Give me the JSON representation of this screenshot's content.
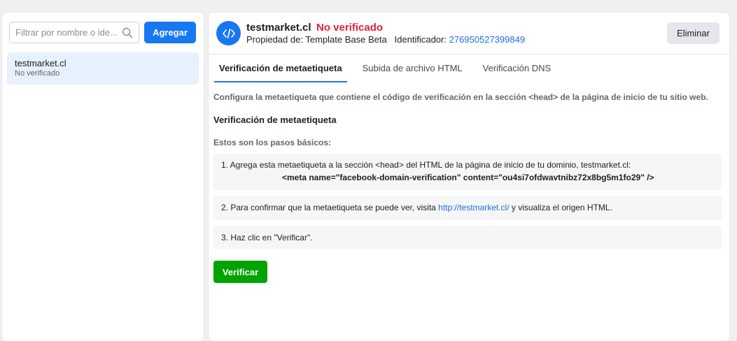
{
  "sidebar": {
    "search": {
      "placeholder": "Filtrar por nombre o ide...",
      "value": ""
    },
    "add_label": "Agregar",
    "items": [
      {
        "name": "testmarket.cl",
        "status": "No verificado"
      }
    ]
  },
  "header": {
    "title": "testmarket.cl",
    "status": "No verificado",
    "owner_label": "Propiedad de:",
    "owner": "Template Base Beta",
    "id_label": "Identificador:",
    "id": "276950527399849",
    "delete_label": "Eliminar"
  },
  "tabs": [
    {
      "label": "Verificación de metaetiqueta",
      "active": true
    },
    {
      "label": "Subida de archivo HTML",
      "active": false
    },
    {
      "label": "Verificación DNS",
      "active": false
    }
  ],
  "content": {
    "intro": "Configura la metaetiqueta que contiene el código de verificación en la sección <head> de la página de inicio de tu sitio web.",
    "section_title": "Verificación de metaetiqueta",
    "steps_intro": "Estos son los pasos básicos:",
    "step1_text": "1. Agrega esta metaetiqueta a la sección <head> del HTML de la página de inicio de tu dominio, testmarket.cl:",
    "step1_meta": "<meta name=\"facebook-domain-verification\" content=\"ou4si7ofdwavtnibz72x8bg5m1fo29\" />",
    "step2_prefix": "2. Para confirmar que la metaetiqueta se puede ver, visita ",
    "step2_link": "http://testmarket.cl/",
    "step2_suffix": " y visualiza el origen HTML.",
    "step3_text": "3. Haz clic en \"Verificar\".",
    "verify_label": "Verificar"
  },
  "colors": {
    "primary": "#1877f2",
    "error": "#e41e3f",
    "success": "#00a400",
    "link": "#216fdb"
  }
}
